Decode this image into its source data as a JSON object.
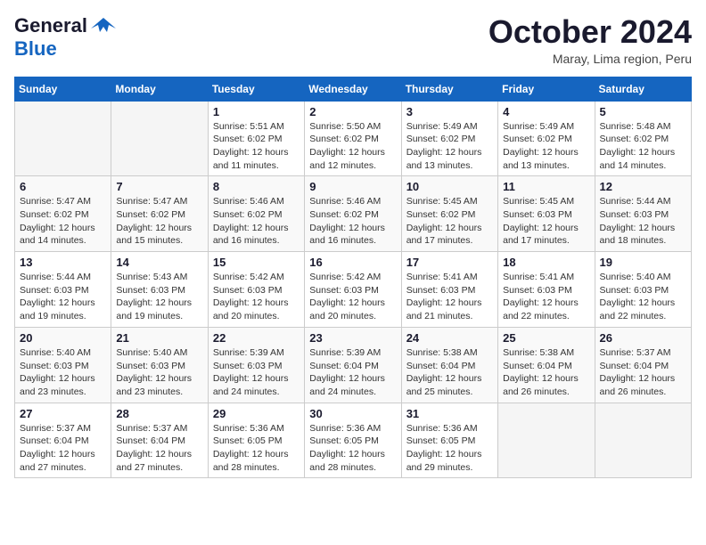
{
  "header": {
    "logo_line1": "General",
    "logo_line2": "Blue",
    "month": "October 2024",
    "location": "Maray, Lima region, Peru"
  },
  "weekdays": [
    "Sunday",
    "Monday",
    "Tuesday",
    "Wednesday",
    "Thursday",
    "Friday",
    "Saturday"
  ],
  "weeks": [
    [
      {
        "day": null
      },
      {
        "day": null
      },
      {
        "day": "1",
        "sunrise": "5:51 AM",
        "sunset": "6:02 PM",
        "daylight": "12 hours and 11 minutes."
      },
      {
        "day": "2",
        "sunrise": "5:50 AM",
        "sunset": "6:02 PM",
        "daylight": "12 hours and 12 minutes."
      },
      {
        "day": "3",
        "sunrise": "5:49 AM",
        "sunset": "6:02 PM",
        "daylight": "12 hours and 13 minutes."
      },
      {
        "day": "4",
        "sunrise": "5:49 AM",
        "sunset": "6:02 PM",
        "daylight": "12 hours and 13 minutes."
      },
      {
        "day": "5",
        "sunrise": "5:48 AM",
        "sunset": "6:02 PM",
        "daylight": "12 hours and 14 minutes."
      }
    ],
    [
      {
        "day": "6",
        "sunrise": "5:47 AM",
        "sunset": "6:02 PM",
        "daylight": "12 hours and 14 minutes."
      },
      {
        "day": "7",
        "sunrise": "5:47 AM",
        "sunset": "6:02 PM",
        "daylight": "12 hours and 15 minutes."
      },
      {
        "day": "8",
        "sunrise": "5:46 AM",
        "sunset": "6:02 PM",
        "daylight": "12 hours and 16 minutes."
      },
      {
        "day": "9",
        "sunrise": "5:46 AM",
        "sunset": "6:02 PM",
        "daylight": "12 hours and 16 minutes."
      },
      {
        "day": "10",
        "sunrise": "5:45 AM",
        "sunset": "6:02 PM",
        "daylight": "12 hours and 17 minutes."
      },
      {
        "day": "11",
        "sunrise": "5:45 AM",
        "sunset": "6:03 PM",
        "daylight": "12 hours and 17 minutes."
      },
      {
        "day": "12",
        "sunrise": "5:44 AM",
        "sunset": "6:03 PM",
        "daylight": "12 hours and 18 minutes."
      }
    ],
    [
      {
        "day": "13",
        "sunrise": "5:44 AM",
        "sunset": "6:03 PM",
        "daylight": "12 hours and 19 minutes."
      },
      {
        "day": "14",
        "sunrise": "5:43 AM",
        "sunset": "6:03 PM",
        "daylight": "12 hours and 19 minutes."
      },
      {
        "day": "15",
        "sunrise": "5:42 AM",
        "sunset": "6:03 PM",
        "daylight": "12 hours and 20 minutes."
      },
      {
        "day": "16",
        "sunrise": "5:42 AM",
        "sunset": "6:03 PM",
        "daylight": "12 hours and 20 minutes."
      },
      {
        "day": "17",
        "sunrise": "5:41 AM",
        "sunset": "6:03 PM",
        "daylight": "12 hours and 21 minutes."
      },
      {
        "day": "18",
        "sunrise": "5:41 AM",
        "sunset": "6:03 PM",
        "daylight": "12 hours and 22 minutes."
      },
      {
        "day": "19",
        "sunrise": "5:40 AM",
        "sunset": "6:03 PM",
        "daylight": "12 hours and 22 minutes."
      }
    ],
    [
      {
        "day": "20",
        "sunrise": "5:40 AM",
        "sunset": "6:03 PM",
        "daylight": "12 hours and 23 minutes."
      },
      {
        "day": "21",
        "sunrise": "5:40 AM",
        "sunset": "6:03 PM",
        "daylight": "12 hours and 23 minutes."
      },
      {
        "day": "22",
        "sunrise": "5:39 AM",
        "sunset": "6:03 PM",
        "daylight": "12 hours and 24 minutes."
      },
      {
        "day": "23",
        "sunrise": "5:39 AM",
        "sunset": "6:04 PM",
        "daylight": "12 hours and 24 minutes."
      },
      {
        "day": "24",
        "sunrise": "5:38 AM",
        "sunset": "6:04 PM",
        "daylight": "12 hours and 25 minutes."
      },
      {
        "day": "25",
        "sunrise": "5:38 AM",
        "sunset": "6:04 PM",
        "daylight": "12 hours and 26 minutes."
      },
      {
        "day": "26",
        "sunrise": "5:37 AM",
        "sunset": "6:04 PM",
        "daylight": "12 hours and 26 minutes."
      }
    ],
    [
      {
        "day": "27",
        "sunrise": "5:37 AM",
        "sunset": "6:04 PM",
        "daylight": "12 hours and 27 minutes."
      },
      {
        "day": "28",
        "sunrise": "5:37 AM",
        "sunset": "6:04 PM",
        "daylight": "12 hours and 27 minutes."
      },
      {
        "day": "29",
        "sunrise": "5:36 AM",
        "sunset": "6:05 PM",
        "daylight": "12 hours and 28 minutes."
      },
      {
        "day": "30",
        "sunrise": "5:36 AM",
        "sunset": "6:05 PM",
        "daylight": "12 hours and 28 minutes."
      },
      {
        "day": "31",
        "sunrise": "5:36 AM",
        "sunset": "6:05 PM",
        "daylight": "12 hours and 29 minutes."
      },
      {
        "day": null
      },
      {
        "day": null
      }
    ]
  ]
}
